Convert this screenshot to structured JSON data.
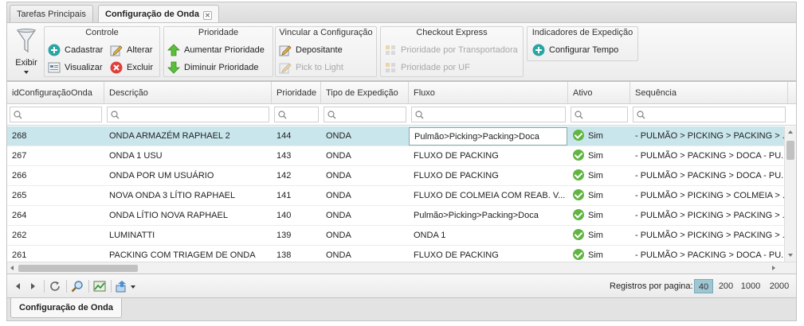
{
  "tabs": [
    {
      "label": "Tarefas Principais",
      "active": false
    },
    {
      "label": "Configuração de Onda",
      "active": true
    }
  ],
  "ribbon": {
    "exibir": "Exibir",
    "groups": {
      "controle": {
        "title": "Controle",
        "cadastrar": "Cadastrar",
        "alterar": "Alterar",
        "visualizar": "Visualizar",
        "excluir": "Excluir"
      },
      "prioridade": {
        "title": "Prioridade",
        "aumentar": "Aumentar Prioridade",
        "diminuir": "Diminuir Prioridade"
      },
      "vincular": {
        "title": "Vincular a Configuração",
        "depositante": "Depositante",
        "pick_to_light": "Pick to Light"
      },
      "checkout": {
        "title": "Checkout Express",
        "transportadora": "Prioridade por Transportadora",
        "uf": "Prioridade por UF"
      },
      "indicadores": {
        "title": "Indicadores de Expedição",
        "configurar_tempo": "Configurar Tempo"
      }
    }
  },
  "grid": {
    "columns": [
      "idConfiguraçãoOnda",
      "Descrição",
      "Prioridade",
      "Tipo de Expedição",
      "Fluxo",
      "Ativo",
      "Sequência"
    ],
    "rows": [
      {
        "id": "268",
        "descricao": "ONDA ARMAZÉM RAPHAEL 2",
        "prioridade": "144",
        "tipo": "ONDA",
        "fluxo": "Pulmão>Picking>Packing>Doca",
        "ativo": "Sim",
        "sequencia": "- PULMÃO > PICKING > PACKING > ..."
      },
      {
        "id": "267",
        "descricao": "ONDA 1 USU",
        "prioridade": "143",
        "tipo": "ONDA",
        "fluxo": "FLUXO DE PACKING",
        "ativo": "Sim",
        "sequencia": "- PULMÃO > PACKING > DOCA - PU..."
      },
      {
        "id": "266",
        "descricao": "ONDA POR UM USUÁRIO",
        "prioridade": "142",
        "tipo": "ONDA",
        "fluxo": "FLUXO DE PACKING",
        "ativo": "Sim",
        "sequencia": "- PULMÃO > PACKING > DOCA - PU..."
      },
      {
        "id": "265",
        "descricao": "NOVA ONDA 3 LÍTIO RAPHAEL",
        "prioridade": "141",
        "tipo": "ONDA",
        "fluxo": "FLUXO DE COLMEIA COM REAB. V...",
        "ativo": "Sim",
        "sequencia": "- PULMÃO > PICKING > COLMEIA > ..."
      },
      {
        "id": "264",
        "descricao": "ONDA LÍTIO NOVA RAPHAEL",
        "prioridade": "140",
        "tipo": "ONDA",
        "fluxo": "Pulmão>Picking>Packing>Doca",
        "ativo": "Sim",
        "sequencia": "- PULMÃO > PICKING > PACKING > ..."
      },
      {
        "id": "262",
        "descricao": "LUMINATTI",
        "prioridade": "139",
        "tipo": "ONDA",
        "fluxo": "ONDA 1",
        "ativo": "Sim",
        "sequencia": "- PULMÃO > PICKING > PACKING > ..."
      },
      {
        "id": "261",
        "descricao": "PACKING COM TRIAGEM DE ONDA",
        "prioridade": "138",
        "tipo": "ONDA",
        "fluxo": "FLUXO DE PACKING",
        "ativo": "Sim",
        "sequencia": "- PULMÃO > PACKING > DOCA - PU..."
      }
    ]
  },
  "pager": {
    "label": "Registros por pagina:",
    "sizes": [
      "40",
      "200",
      "1000",
      "2000"
    ],
    "selected": "40"
  },
  "bottom_tab": "Configuração de Onda",
  "colors": {
    "selected_row": "#c9e6ec",
    "active_ok": "#62b543",
    "page_size_active": "#9fc7d3"
  }
}
